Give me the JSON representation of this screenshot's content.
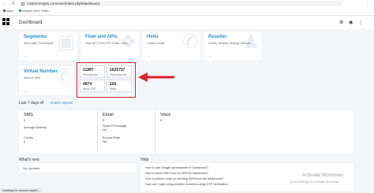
{
  "browser": {
    "url": "control.msg91.com/user/index.php#dashboard",
    "bookmarks": {
      "apps_label": "Apps",
      "item_label": "Migrate from Twilio..."
    }
  },
  "page": {
    "title": "Dashboard"
  },
  "services": [
    {
      "title": "Segmento",
      "desc": "Send SMS, Promotional",
      "icon": "megaphone-icon"
    },
    {
      "title": "Flow and APIs",
      "desc": "Flow, API, Send OTP, Email, Voice",
      "icon": "code-icon"
    },
    {
      "title": "Hello",
      "desc": "Contact center",
      "icon": "phone-icon"
    },
    {
      "title": "Reseller",
      "desc": "Clients, Reseller Settings, Website",
      "icon": "user-icon"
    }
  ],
  "virtual_number": {
    "title": "Virtual Number",
    "desc": "Receive SMS"
  },
  "stats": [
    {
      "value": "11987",
      "label": "Promotional"
    },
    {
      "value": "1625737",
      "label": "Transactional"
    },
    {
      "value": "4874",
      "label": "Send OTP"
    },
    {
      "value": "104",
      "label": "Inbox"
    }
  ],
  "last7": {
    "label": "Last 7 days of",
    "link": "Check reports"
  },
  "summary": {
    "sms": {
      "head": "SMS",
      "value": "0",
      "rows": [
        {
          "label": "Average Delivery",
          "value": ""
        },
        {
          "label": "Credits",
          "value": "0"
        }
      ]
    },
    "email": {
      "head": "Email",
      "value": "0",
      "rows": [
        {
          "label": "Spam Percentage",
          "value": "NA"
        },
        {
          "label": "Bounce Rate",
          "value": "NA"
        }
      ]
    },
    "voice": {
      "head": "Voice",
      "value": "0"
    }
  },
  "whats_new": {
    "title": "What's new",
    "empty": "No Updates"
  },
  "help": {
    "title": "Help",
    "items": [
      "How to use Google spreadsheet in Dashboard?",
      "How to send SMS from my MSG91 dashboard?",
      "How to search route for sending SMS from the dashboard?",
      "How can I login using multiple numbers using OTP Verification"
    ]
  },
  "watermark": {
    "line1": "Activate Windows",
    "line2": "Go to Settings to activate Windows."
  },
  "status_bar": "Waiting for control.msg91..."
}
